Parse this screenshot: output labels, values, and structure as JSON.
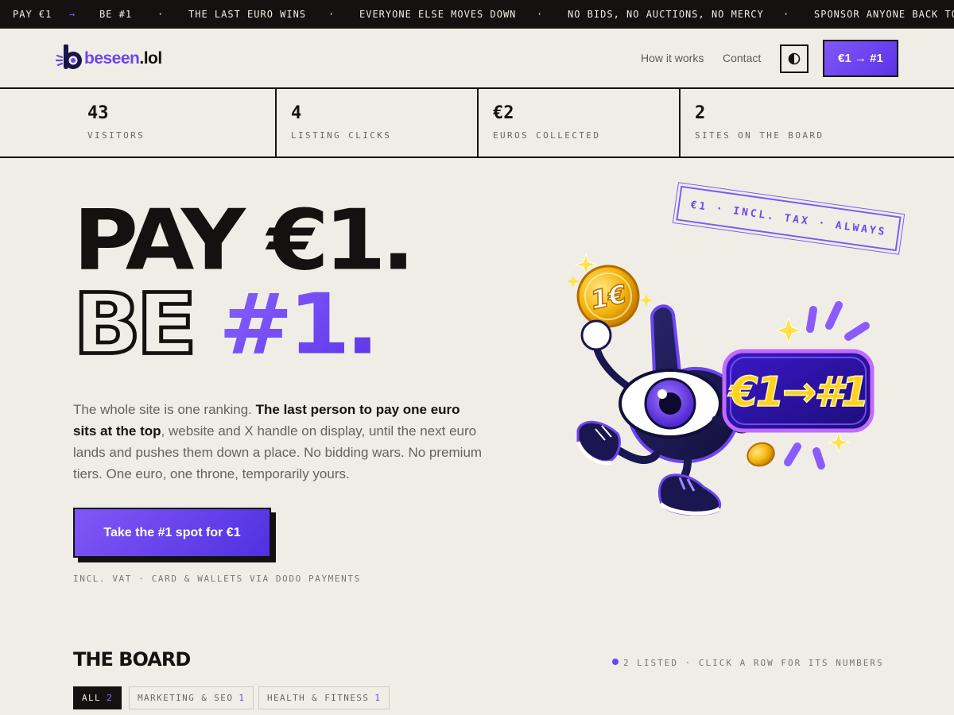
{
  "ticker": {
    "items": [
      "PAY €1",
      "→",
      "BE #1",
      "·",
      "THE LAST EURO WINS",
      "·",
      "EVERYONE ELSE MOVES DOWN",
      "·",
      "NO BIDS, NO AUCTIONS, NO MERCY",
      "·",
      "SPONSOR ANYONE BACK TO"
    ]
  },
  "header": {
    "logo_primary": "beseen",
    "logo_suffix": ".lol",
    "nav": [
      "How it works",
      "Contact"
    ],
    "cta_label": "€1 → #1",
    "theme_icon": "contrast-icon"
  },
  "stats": [
    {
      "value": "43",
      "label": "VISITORS"
    },
    {
      "value": "4",
      "label": "LISTING CLICKS"
    },
    {
      "value": "€2",
      "label": "EUROS COLLECTED"
    },
    {
      "value": "2",
      "label": "SITES ON THE BOARD"
    }
  ],
  "hero": {
    "line1": "PAY €1.",
    "line2_outline": "BE",
    "line2_accent": "#1.",
    "desc_pre": "The whole site is one ranking. ",
    "desc_bold": "The last person to pay one euro sits at the top",
    "desc_post": ", website and X handle on display, until the next euro lands and pushes them down a place. No bidding wars. No premium tiers. One euro, one throne, temporarily yours.",
    "cta_label": "Take the #1 spot for €1",
    "cta_note": "INCL. VAT · CARD & WALLETS VIA DODO PAYMENTS",
    "stamp": "€1 · INCL. TAX · ALWAYS",
    "mascot_coin": "1€",
    "mascot_sign": "€1→#1"
  },
  "board": {
    "title": "THE BOARD",
    "status": "2 LISTED · CLICK A ROW FOR ITS NUMBERS",
    "filters": [
      {
        "label": "ALL",
        "count": "2",
        "active": true
      },
      {
        "label": "MARKETING & SEO",
        "count": "1",
        "active": false
      },
      {
        "label": "HEALTH & FITNESS",
        "count": "1",
        "active": false
      }
    ]
  },
  "colors": {
    "accent": "#6d45f0",
    "background": "#f0ede6",
    "ink": "#141210"
  }
}
